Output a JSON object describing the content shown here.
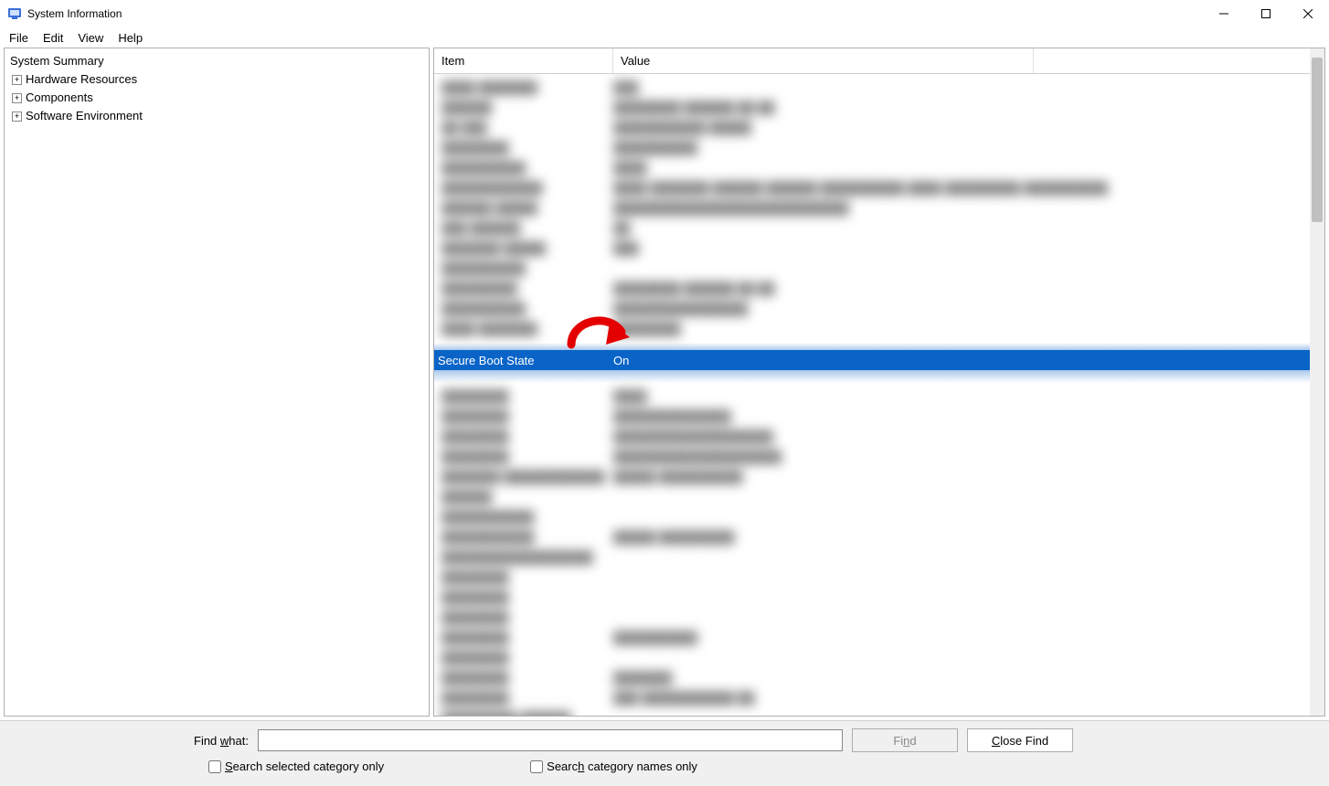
{
  "window": {
    "title": "System Information"
  },
  "menu": {
    "file": "File",
    "edit": "Edit",
    "view": "View",
    "help": "Help"
  },
  "tree": {
    "root": "System Summary",
    "items": [
      "Hardware Resources",
      "Components",
      "Software Environment"
    ]
  },
  "columns": {
    "item": "Item",
    "value": "Value"
  },
  "selected_row": {
    "item": "Secure Boot State",
    "value": "On"
  },
  "find": {
    "label_prefix": "Find ",
    "label_accel": "w",
    "label_suffix": "hat:",
    "value": "",
    "find_prefix": "Fi",
    "find_accel": "n",
    "find_suffix": "d",
    "close_prefix": "",
    "close_accel": "C",
    "close_suffix": "lose Find",
    "search_selected_prefix": "",
    "search_selected_accel": "S",
    "search_selected_suffix": "earch selected category only",
    "search_names_prefix": "Searc",
    "search_names_accel": "h",
    "search_names_suffix": " category names only"
  }
}
